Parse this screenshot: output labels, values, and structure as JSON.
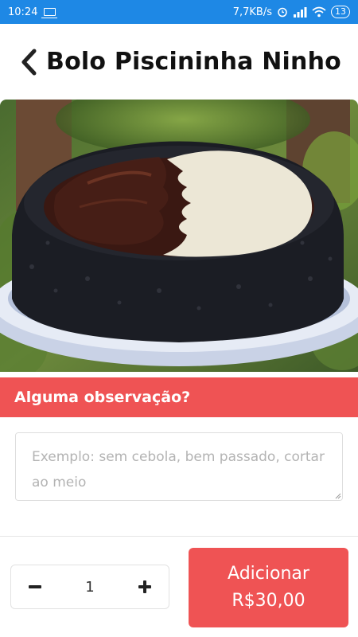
{
  "status_bar": {
    "time": "10:24",
    "network_speed": "7,7KB/s",
    "battery": "13",
    "icons": [
      "laptop-icon",
      "alarm-icon",
      "signal-icon",
      "wifi-icon",
      "battery-icon"
    ],
    "color": "#1e88e5"
  },
  "header": {
    "title": "Bolo Piscininha Ninho c",
    "back_icon": "chevron-left-icon"
  },
  "product": {
    "image": "cake-photo"
  },
  "observation": {
    "label": "Alguma observação?",
    "placeholder": "Exemplo: sem cebola, bem passado, cortar ao meio",
    "value": ""
  },
  "order": {
    "quantity": "1",
    "minus_icon": "minus-icon",
    "plus_icon": "plus-icon",
    "add_label": "Adicionar",
    "price": "R$30,00"
  },
  "colors": {
    "accent": "#ef5354",
    "status_bar": "#1e88e5"
  }
}
